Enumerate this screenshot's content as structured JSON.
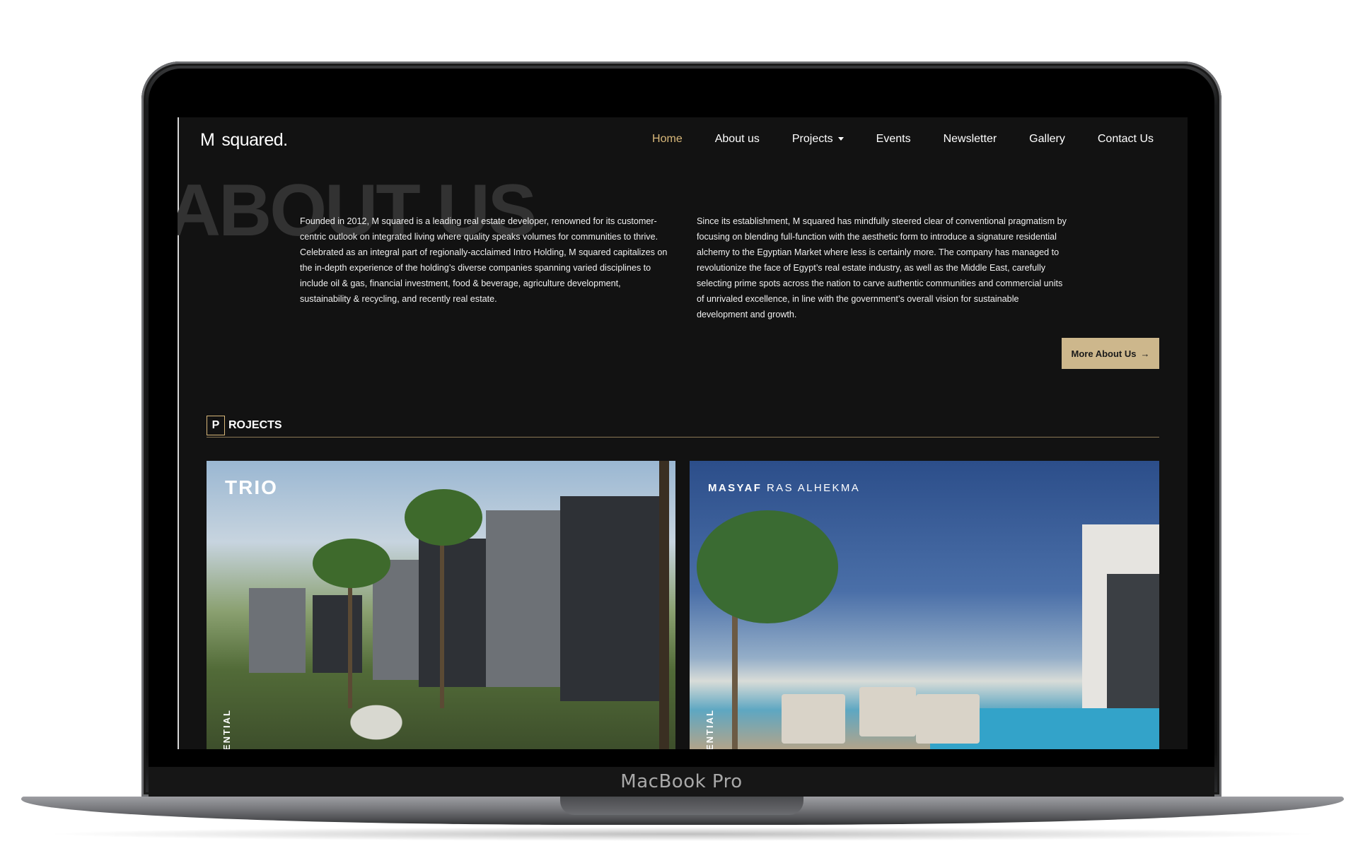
{
  "device": {
    "label": "MacBook Pro"
  },
  "header": {
    "logo_m": "M",
    "logo_text": "squared.",
    "nav": [
      {
        "label": "Home",
        "active": true
      },
      {
        "label": "About us"
      },
      {
        "label": "Projects"
      },
      {
        "label": "Events"
      },
      {
        "label": "Newsletter"
      },
      {
        "label": "Gallery"
      },
      {
        "label": "Contact Us"
      }
    ]
  },
  "about": {
    "watermark": "ABOUT US",
    "paragraph_left": "Founded in 2012, M squared is a leading real estate developer, renowned for its customer-centric outlook on integrated living where quality speaks volumes for communities to thrive. Celebrated as an integral part of regionally-acclaimed Intro Holding, M squared capitalizes on the in-depth experience of the holding’s diverse companies spanning varied disciplines to include oil & gas, financial investment, food & beverage, agriculture development, sustainability & recycling, and recently real estate.",
    "paragraph_right": "Since its establishment, M squared has mindfully steered clear of conventional pragmatism by focusing on blending full-function with the aesthetic form to introduce a signature residential alchemy to the Egyptian Market where less is certainly more. The company has managed to revolutionize the face of Egypt’s real estate industry, as well as the Middle East, carefully selecting prime spots across the nation to carve authentic communities and commercial units of unrivaled excellence, in line with the government’s overall vision for sustainable development and growth.",
    "more_button": "More About Us",
    "more_arrow": "→"
  },
  "projects": {
    "box_letter": "P",
    "label": "ROJECTS",
    "cards": [
      {
        "title": "TRIO",
        "vertical_label": "ENTIAL"
      },
      {
        "title_bold": "MASYAF",
        "title_light": "RAS ALHEKMA",
        "vertical_label": "ENTIAL"
      }
    ]
  }
}
